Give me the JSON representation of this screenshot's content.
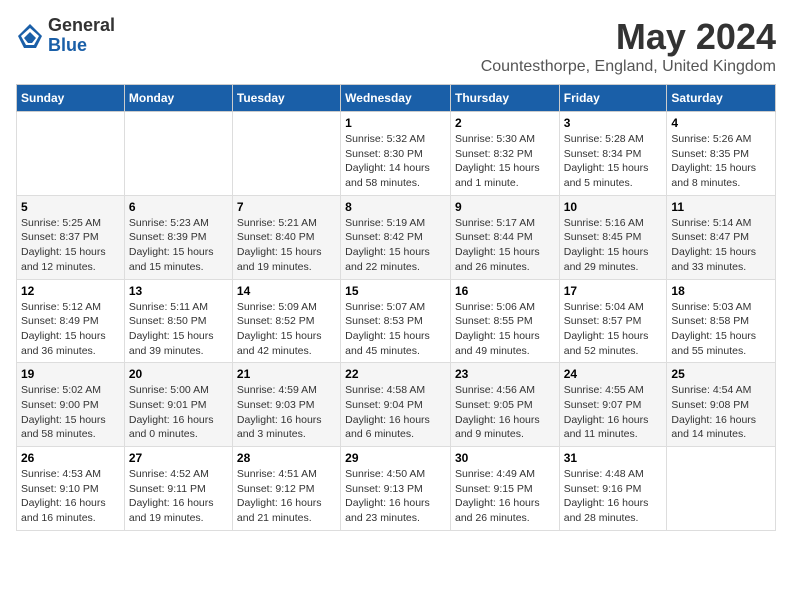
{
  "logo": {
    "general": "General",
    "blue": "Blue"
  },
  "title": "May 2024",
  "location": "Countesthorpe, England, United Kingdom",
  "days_of_week": [
    "Sunday",
    "Monday",
    "Tuesday",
    "Wednesday",
    "Thursday",
    "Friday",
    "Saturday"
  ],
  "weeks": [
    [
      {
        "day": "",
        "info": ""
      },
      {
        "day": "",
        "info": ""
      },
      {
        "day": "",
        "info": ""
      },
      {
        "day": "1",
        "info": "Sunrise: 5:32 AM\nSunset: 8:30 PM\nDaylight: 14 hours\nand 58 minutes."
      },
      {
        "day": "2",
        "info": "Sunrise: 5:30 AM\nSunset: 8:32 PM\nDaylight: 15 hours\nand 1 minute."
      },
      {
        "day": "3",
        "info": "Sunrise: 5:28 AM\nSunset: 8:34 PM\nDaylight: 15 hours\nand 5 minutes."
      },
      {
        "day": "4",
        "info": "Sunrise: 5:26 AM\nSunset: 8:35 PM\nDaylight: 15 hours\nand 8 minutes."
      }
    ],
    [
      {
        "day": "5",
        "info": "Sunrise: 5:25 AM\nSunset: 8:37 PM\nDaylight: 15 hours\nand 12 minutes."
      },
      {
        "day": "6",
        "info": "Sunrise: 5:23 AM\nSunset: 8:39 PM\nDaylight: 15 hours\nand 15 minutes."
      },
      {
        "day": "7",
        "info": "Sunrise: 5:21 AM\nSunset: 8:40 PM\nDaylight: 15 hours\nand 19 minutes."
      },
      {
        "day": "8",
        "info": "Sunrise: 5:19 AM\nSunset: 8:42 PM\nDaylight: 15 hours\nand 22 minutes."
      },
      {
        "day": "9",
        "info": "Sunrise: 5:17 AM\nSunset: 8:44 PM\nDaylight: 15 hours\nand 26 minutes."
      },
      {
        "day": "10",
        "info": "Sunrise: 5:16 AM\nSunset: 8:45 PM\nDaylight: 15 hours\nand 29 minutes."
      },
      {
        "day": "11",
        "info": "Sunrise: 5:14 AM\nSunset: 8:47 PM\nDaylight: 15 hours\nand 33 minutes."
      }
    ],
    [
      {
        "day": "12",
        "info": "Sunrise: 5:12 AM\nSunset: 8:49 PM\nDaylight: 15 hours\nand 36 minutes."
      },
      {
        "day": "13",
        "info": "Sunrise: 5:11 AM\nSunset: 8:50 PM\nDaylight: 15 hours\nand 39 minutes."
      },
      {
        "day": "14",
        "info": "Sunrise: 5:09 AM\nSunset: 8:52 PM\nDaylight: 15 hours\nand 42 minutes."
      },
      {
        "day": "15",
        "info": "Sunrise: 5:07 AM\nSunset: 8:53 PM\nDaylight: 15 hours\nand 45 minutes."
      },
      {
        "day": "16",
        "info": "Sunrise: 5:06 AM\nSunset: 8:55 PM\nDaylight: 15 hours\nand 49 minutes."
      },
      {
        "day": "17",
        "info": "Sunrise: 5:04 AM\nSunset: 8:57 PM\nDaylight: 15 hours\nand 52 minutes."
      },
      {
        "day": "18",
        "info": "Sunrise: 5:03 AM\nSunset: 8:58 PM\nDaylight: 15 hours\nand 55 minutes."
      }
    ],
    [
      {
        "day": "19",
        "info": "Sunrise: 5:02 AM\nSunset: 9:00 PM\nDaylight: 15 hours\nand 58 minutes."
      },
      {
        "day": "20",
        "info": "Sunrise: 5:00 AM\nSunset: 9:01 PM\nDaylight: 16 hours\nand 0 minutes."
      },
      {
        "day": "21",
        "info": "Sunrise: 4:59 AM\nSunset: 9:03 PM\nDaylight: 16 hours\nand 3 minutes."
      },
      {
        "day": "22",
        "info": "Sunrise: 4:58 AM\nSunset: 9:04 PM\nDaylight: 16 hours\nand 6 minutes."
      },
      {
        "day": "23",
        "info": "Sunrise: 4:56 AM\nSunset: 9:05 PM\nDaylight: 16 hours\nand 9 minutes."
      },
      {
        "day": "24",
        "info": "Sunrise: 4:55 AM\nSunset: 9:07 PM\nDaylight: 16 hours\nand 11 minutes."
      },
      {
        "day": "25",
        "info": "Sunrise: 4:54 AM\nSunset: 9:08 PM\nDaylight: 16 hours\nand 14 minutes."
      }
    ],
    [
      {
        "day": "26",
        "info": "Sunrise: 4:53 AM\nSunset: 9:10 PM\nDaylight: 16 hours\nand 16 minutes."
      },
      {
        "day": "27",
        "info": "Sunrise: 4:52 AM\nSunset: 9:11 PM\nDaylight: 16 hours\nand 19 minutes."
      },
      {
        "day": "28",
        "info": "Sunrise: 4:51 AM\nSunset: 9:12 PM\nDaylight: 16 hours\nand 21 minutes."
      },
      {
        "day": "29",
        "info": "Sunrise: 4:50 AM\nSunset: 9:13 PM\nDaylight: 16 hours\nand 23 minutes."
      },
      {
        "day": "30",
        "info": "Sunrise: 4:49 AM\nSunset: 9:15 PM\nDaylight: 16 hours\nand 26 minutes."
      },
      {
        "day": "31",
        "info": "Sunrise: 4:48 AM\nSunset: 9:16 PM\nDaylight: 16 hours\nand 28 minutes."
      },
      {
        "day": "",
        "info": ""
      }
    ]
  ]
}
